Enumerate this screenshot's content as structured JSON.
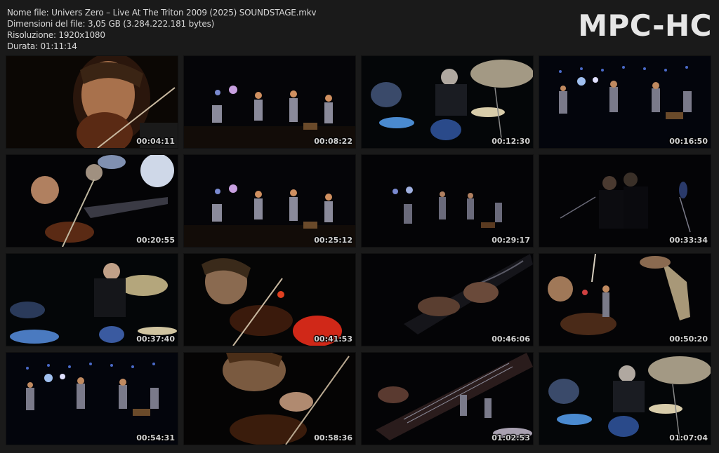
{
  "info": {
    "filename": "Nome file: Univers Zero – Live At The Triton 2009 (2025) SOUNDSTAGE.mkv",
    "filesize": "Dimensioni del file: 3,05 GB (3.284.222.181 bytes)",
    "resolution": "Risoluzione: 1920x1080",
    "duration": "Durata: 01:11:14"
  },
  "logo": "MPC-HC",
  "thumbnails": [
    {
      "time": "00:04:11",
      "scene": "violinist-closeup"
    },
    {
      "time": "00:08:22",
      "scene": "stage-wide"
    },
    {
      "time": "00:12:30",
      "scene": "drummer-cymbals"
    },
    {
      "time": "00:16:50",
      "scene": "stage-wide-blue"
    },
    {
      "time": "00:20:55",
      "scene": "violin-guitar-duo"
    },
    {
      "time": "00:25:12",
      "scene": "stage-wide"
    },
    {
      "time": "00:29:17",
      "scene": "stage-wide-dark"
    },
    {
      "time": "00:33:34",
      "scene": "dark-performers"
    },
    {
      "time": "00:37:40",
      "scene": "drummer-kit"
    },
    {
      "time": "00:41:53",
      "scene": "violinist-red-light"
    },
    {
      "time": "00:46:06",
      "scene": "guitar-hands"
    },
    {
      "time": "00:50:20",
      "scene": "violin-stage-sax"
    },
    {
      "time": "00:54:31",
      "scene": "stage-wide-blue"
    },
    {
      "time": "00:58:36",
      "scene": "violinist-bowing"
    },
    {
      "time": "01:02:53",
      "scene": "guitar-neck-stage"
    },
    {
      "time": "01:07:04",
      "scene": "drummer-cymbals"
    }
  ]
}
